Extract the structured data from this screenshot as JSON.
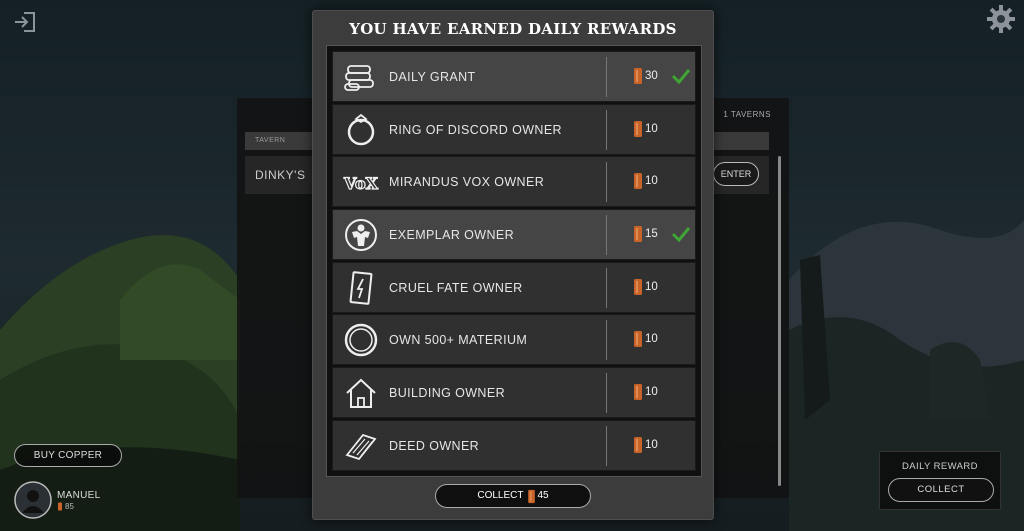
{
  "modal": {
    "title": "YOU HAVE EARNED DAILY REWARDS",
    "rewards": [
      {
        "label": "DAILY GRANT",
        "amount": "30",
        "earned": true,
        "icon": "coins-stack-icon"
      },
      {
        "label": "RING OF DISCORD OWNER",
        "amount": "10",
        "earned": false,
        "icon": "ring-icon"
      },
      {
        "label": "MIRANDUS VOX OWNER",
        "amount": "10",
        "earned": false,
        "icon": "vox-logo-icon"
      },
      {
        "label": "EXEMPLAR OWNER",
        "amount": "15",
        "earned": true,
        "icon": "exemplar-icon"
      },
      {
        "label": "CRUEL FATE OWNER",
        "amount": "10",
        "earned": false,
        "icon": "card-icon"
      },
      {
        "label": "OWN 500+ MATERIUM",
        "amount": "10",
        "earned": false,
        "icon": "materium-coin-icon"
      },
      {
        "label": "BUILDING OWNER",
        "amount": "10",
        "earned": false,
        "icon": "house-icon"
      },
      {
        "label": "DEED OWNER",
        "amount": "10",
        "earned": false,
        "icon": "deed-icon"
      }
    ],
    "collect": {
      "label": "COLLECT",
      "amount": "45"
    }
  },
  "tavern": {
    "count": "1 TAVERNS",
    "column_header": "TAVERN",
    "row": {
      "name": "DINKY'S",
      "enter_label": "ENTER"
    }
  },
  "bottom_left": {
    "buy_copper_label": "BUY COPPER",
    "user_name": "MANUEL",
    "user_copper": "85"
  },
  "daily_reward": {
    "title": "DAILY REWARD",
    "collect_label": "COLLECT"
  },
  "colors": {
    "copper": "#c8642a",
    "check": "#3fa534",
    "modal_bg": "#3c3c3c"
  }
}
